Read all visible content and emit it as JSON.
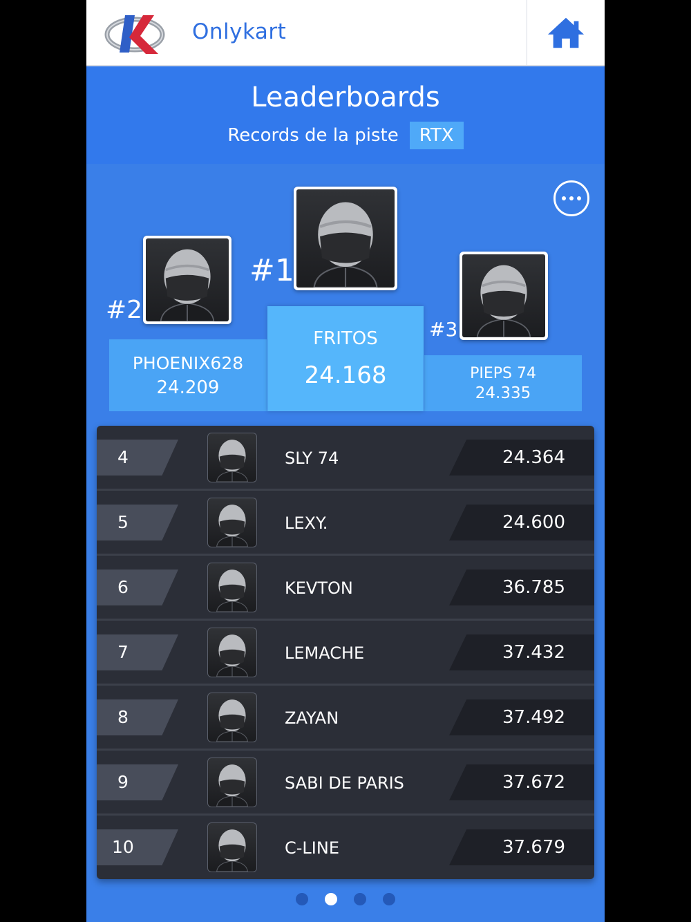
{
  "app": {
    "brand": "Onlykart"
  },
  "header": {
    "title": "Leaderboards",
    "subtitle": "Records de la piste",
    "track": "RTX"
  },
  "podium": [
    {
      "rank": "#1",
      "name": "FRITOS",
      "time": "24.168"
    },
    {
      "rank": "#2",
      "name": "PHOENIX628",
      "time": "24.209"
    },
    {
      "rank": "#3",
      "name": "PIEPS 74",
      "time": "24.335"
    }
  ],
  "rows": [
    {
      "pos": "4",
      "name": "SLY 74",
      "time": "24.364"
    },
    {
      "pos": "5",
      "name": "LEXY.",
      "time": "24.600"
    },
    {
      "pos": "6",
      "name": "KEVTON",
      "time": "36.785"
    },
    {
      "pos": "7",
      "name": "LEMACHE",
      "time": "37.432"
    },
    {
      "pos": "8",
      "name": "ZAYAN",
      "time": "37.492"
    },
    {
      "pos": "9",
      "name": "SABI DE PARIS",
      "time": "37.672"
    },
    {
      "pos": "10",
      "name": "C-LINE",
      "time": "37.679"
    }
  ],
  "pager": {
    "pages": 4,
    "active_page": 2
  },
  "icons": {
    "home": "home-icon",
    "more": "more-options-icon",
    "avatar": "helmet-avatar-icon"
  },
  "colors": {
    "accent": "#3279ec",
    "podium_first": "#55b6fb",
    "podium_side": "#4aa4f5",
    "table_bg": "#2b2e37"
  }
}
